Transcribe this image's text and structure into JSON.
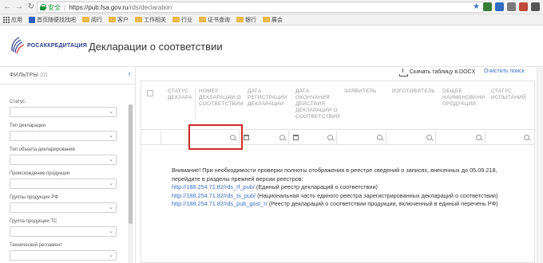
{
  "browser": {
    "secure_label": "安全",
    "url_host": "https://pub.fsa.gov.ru",
    "url_path": "/rds/declaration",
    "bookmarks": [
      "应用",
      "首页随便找找吧",
      "阅行",
      "客户",
      "工作相关",
      "行业",
      "证书查询",
      "银行",
      "展会"
    ]
  },
  "header": {
    "logo_text": "РОСАККРЕДИТАЦИЯ",
    "page_title": "Декларации о соответствии"
  },
  "sidebar": {
    "filters_title": "ФИЛЬТРЫ",
    "filters_count": "(0)",
    "collapse_icon": "chevron-left-icon",
    "filters": [
      {
        "label": "Статус"
      },
      {
        "label": "Тип декларации"
      },
      {
        "label": "Тип объекта декларирования"
      },
      {
        "label": "Происхождение продукции"
      },
      {
        "label": "Группы продукции РФ"
      },
      {
        "label": "Группа продукции ТС"
      },
      {
        "label": "Технический регламент"
      }
    ]
  },
  "toolbar": {
    "download_label": "Скачать таблицу в DOCX",
    "clear_label": "Очистить поиск"
  },
  "table": {
    "columns": [
      "СТАТУС ДЕКЛАРА",
      "НОМЕР ДЕКЛАРАЦИИ О СООТВЕТСТВИИ",
      "ДАТА РЕГИСТРАЦИИ ДЕКЛАРАЦИИ",
      "ДАТА ОКОНЧАНИЯ ДЕЙСТВИЯ ДЕКЛАРАЦИИ О СООТВЕТСТВИИ",
      "ЗАЯВИТЕЛЬ",
      "ИЗГОТОВИТЕЛЬ",
      "ОБЩЕЕ НАИМЕНОВАНИ ПРОДУКЦИИ",
      "СТАТУС ИСПЫТАНИЙ"
    ]
  },
  "notice": {
    "line1": "Внимание! При необходимости проверки полноты отображения в реестре сведений о записях, внесенных до 05.09.218,",
    "line2": "перейдите в разделы прежней версии реестров:",
    "links": [
      {
        "url": "http://188.254.71.82/rds_rf_pub/",
        "desc": " (Единый реестр деклараций о соответствии)"
      },
      {
        "url": "http://188.254.71.82/rds_ts_pub/",
        "desc": " (Национальная часть единого реестра зарегистрированных деклараций о соответствии)"
      },
      {
        "url": "http://188.254.71.82/rds_pub_gost_r/",
        "desc": " (Реестр деклараций о соответствии продукции, включенный в единый перечень РФ)"
      }
    ]
  },
  "colors": {
    "accent": "#3b6fc4",
    "highlight": "#d12a2a",
    "secure": "#1a8f3a"
  }
}
